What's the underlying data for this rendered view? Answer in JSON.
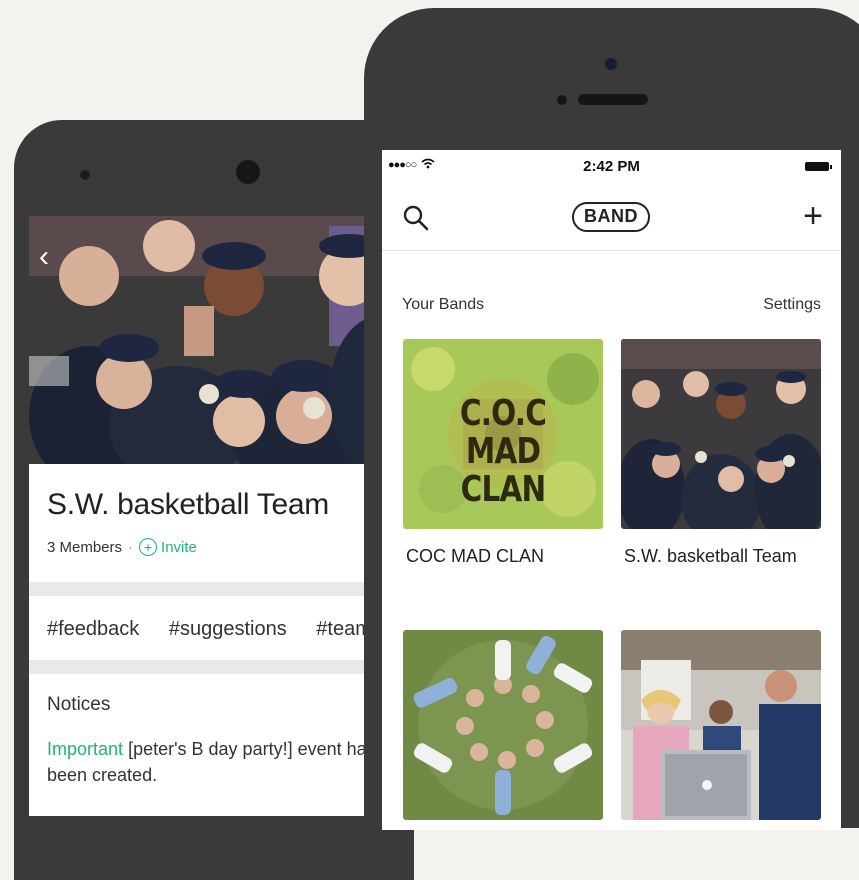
{
  "android": {
    "band_title": "S.W. basketball Team",
    "members": "3 Members",
    "separator_dot": "·",
    "invite_label": "Invite",
    "hashtags": [
      "#feedback",
      "#suggestions",
      "#team-m"
    ],
    "notices_heading": "Notices",
    "notice": {
      "tag": "Important",
      "text": "[peter's B day party!] event has been created."
    }
  },
  "iphone": {
    "status": {
      "signal": "●●●○○",
      "time": "2:42 PM"
    },
    "nav": {
      "logo": "BAND",
      "add_label": "+"
    },
    "section_title": "Your Bands",
    "settings_label": "Settings",
    "bands": [
      {
        "name": "COC MAD CLAN",
        "cover_text": [
          "C.O.C",
          "MAD CLAN"
        ]
      },
      {
        "name": "S.W. basketball Team"
      }
    ]
  },
  "colors": {
    "accent_green": "#1fb37a",
    "device_body": "#3a3a3a"
  },
  "icons": [
    "back-chevron-icon",
    "invite-plus-icon",
    "search-icon",
    "wifi-icon",
    "battery-icon",
    "add-icon"
  ]
}
